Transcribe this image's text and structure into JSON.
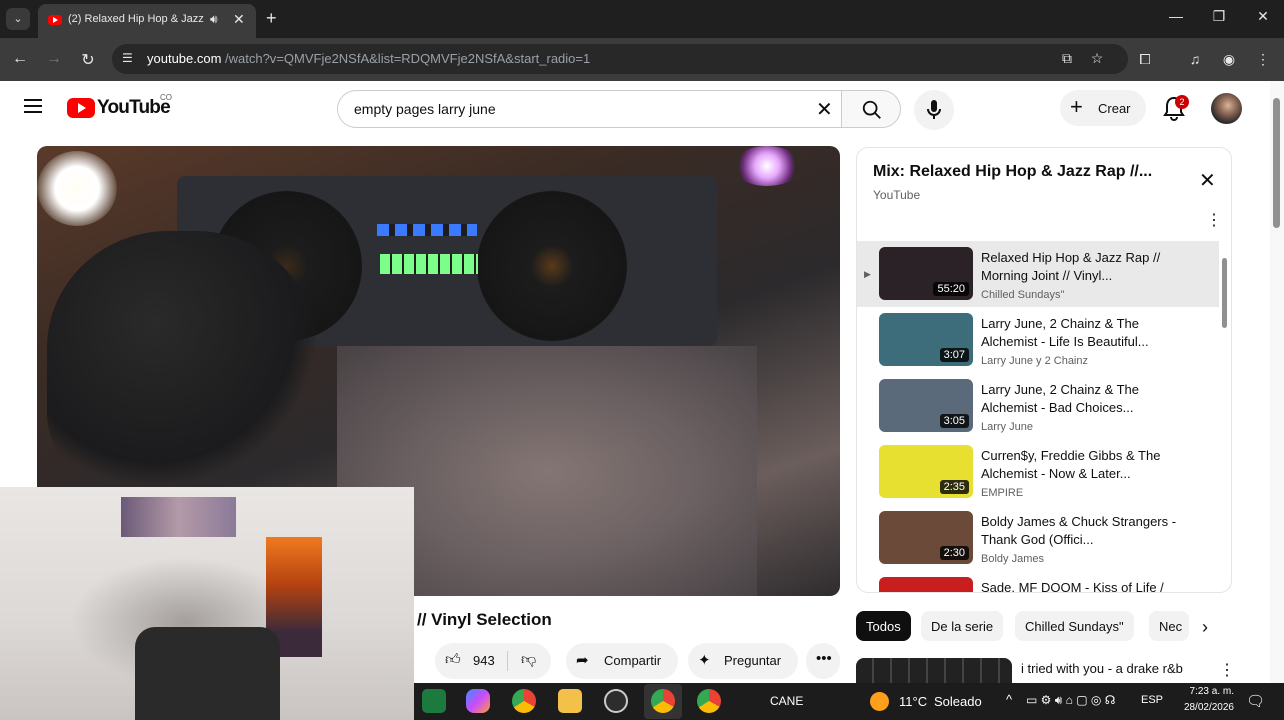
{
  "browser": {
    "tab_title": "(2) Relaxed Hip Hop & Jazz",
    "url_host": "youtube.com",
    "url_path": "/watch?v=QMVFje2NSfA&list=RDQMVFje2NSfA&start_radio=1"
  },
  "header": {
    "logo_text": "YouTube",
    "country_code": "CO",
    "search_value": "empty pages larry june",
    "create_label": "Crear",
    "notification_count": "2"
  },
  "video": {
    "title": "// Vinyl Selection",
    "like_count": "943",
    "share_label": "Compartir",
    "ask_label": "Preguntar"
  },
  "playlist": {
    "title": "Mix: Relaxed Hip Hop & Jazz Rap //...",
    "channel": "YouTube",
    "items": [
      {
        "title": "Relaxed Hip Hop & Jazz Rap // Morning Joint // Vinyl...",
        "channel": "Chilled Sundays\"",
        "duration": "55:20",
        "active": true,
        "thumb_color": "#2a2226"
      },
      {
        "title": "Larry June, 2 Chainz & The Alchemist - Life Is Beautiful...",
        "channel": "Larry June y 2 Chainz",
        "duration": "3:07",
        "active": false,
        "thumb_color": "#3d6d7a"
      },
      {
        "title": "Larry June, 2 Chainz & The Alchemist - Bad Choices...",
        "channel": "Larry June",
        "duration": "3:05",
        "active": false,
        "thumb_color": "#5a6a7a"
      },
      {
        "title": "Curren$y, Freddie Gibbs & The Alchemist - Now & Later...",
        "channel": "EMPIRE",
        "duration": "2:35",
        "active": false,
        "thumb_color": "#e8e030"
      },
      {
        "title": "Boldy James & Chuck Strangers - Thank God (Offici...",
        "channel": "Boldy James",
        "duration": "2:30",
        "active": false,
        "thumb_color": "#6b4a3a"
      },
      {
        "title": "Sade, MF DOOM - Kiss of Life /",
        "channel": "",
        "duration": "",
        "active": false,
        "thumb_color": "#c81e1e"
      }
    ]
  },
  "chips": [
    "Todos",
    "De la serie",
    "Chilled Sundays\"",
    "Nec"
  ],
  "next_video_title": "i tried with you - a drake r&b",
  "taskbar": {
    "label": "CANE",
    "temperature": "11°C",
    "weather": "Soleado",
    "language": "ESP",
    "time": "7:23 a. m.",
    "date": "28/02/2026"
  }
}
